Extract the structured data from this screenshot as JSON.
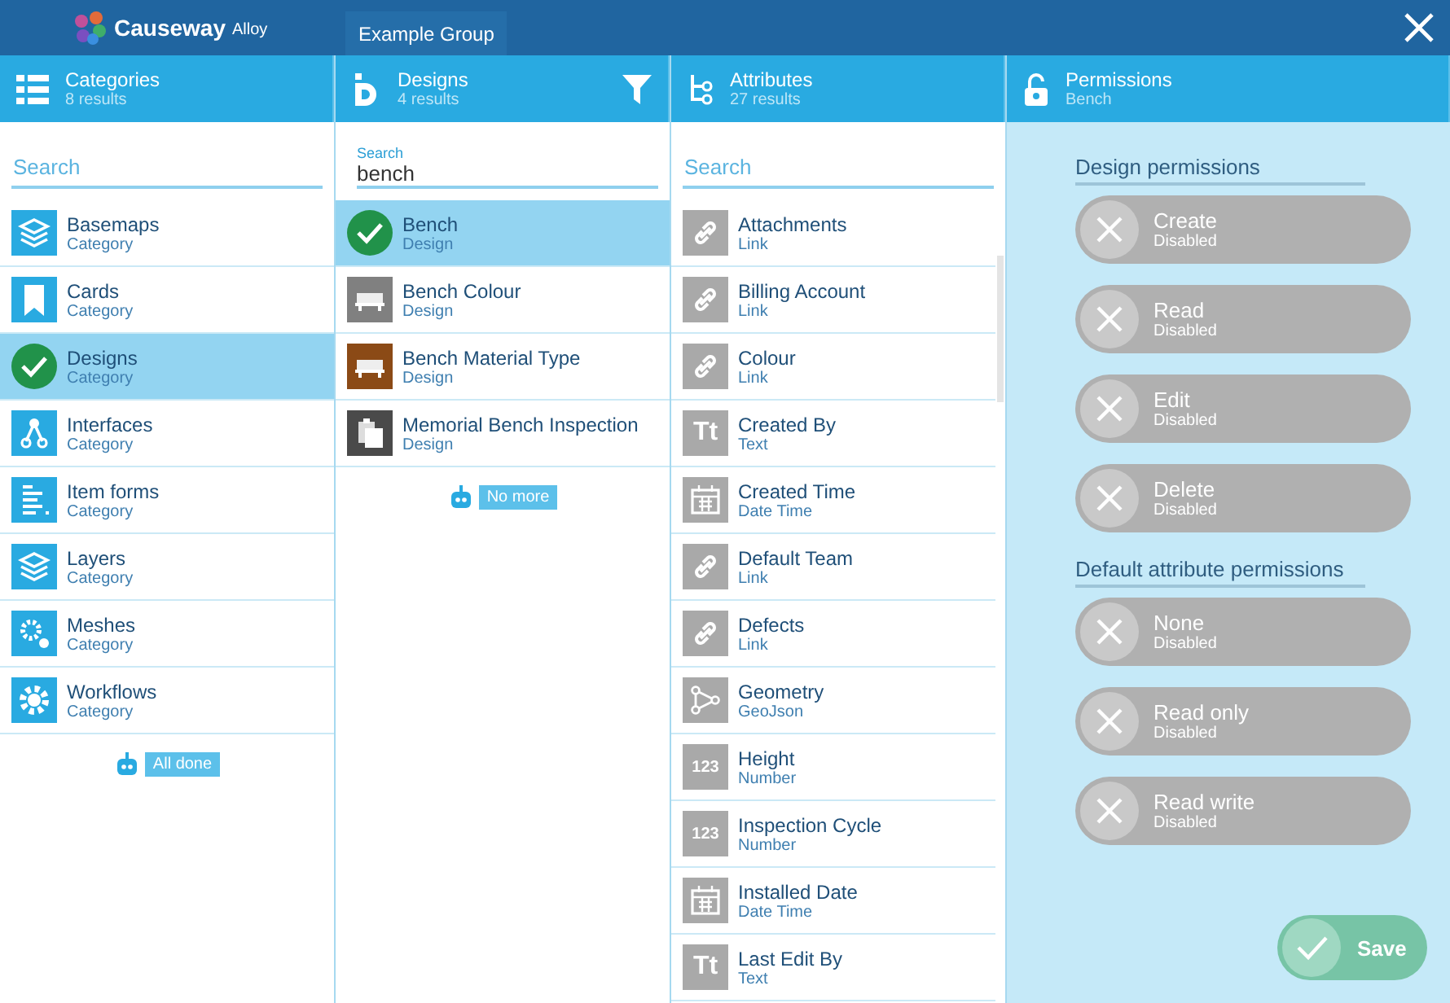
{
  "topbar": {
    "brand": "Causeway",
    "brand_suffix": "Alloy",
    "group": "Example Group"
  },
  "categories": {
    "title": "Categories",
    "subtitle": "8 results",
    "search": {
      "placeholder": "Search"
    },
    "items": [
      {
        "name": "Basemaps",
        "type": "Category",
        "kind": "stack",
        "selected": false
      },
      {
        "name": "Cards",
        "type": "Category",
        "kind": "bookmark",
        "selected": false
      },
      {
        "name": "Designs",
        "type": "Category",
        "selected": true
      },
      {
        "name": "Interfaces",
        "type": "Category",
        "kind": "nodes",
        "selected": false
      },
      {
        "name": "Item forms",
        "type": "Category",
        "kind": "form",
        "selected": false
      },
      {
        "name": "Layers",
        "type": "Category",
        "kind": "stack",
        "selected": false
      },
      {
        "name": "Meshes",
        "type": "Category",
        "kind": "gears",
        "selected": false
      },
      {
        "name": "Workflows",
        "type": "Category",
        "kind": "gear",
        "selected": false
      }
    ],
    "footer": "All done"
  },
  "designs": {
    "title": "Designs",
    "subtitle": "4 results",
    "search": {
      "label": "Search",
      "value": "bench"
    },
    "items": [
      {
        "name": "Bench",
        "type": "Design",
        "selected": true
      },
      {
        "name": "Bench Colour",
        "type": "Design",
        "kind": "bench",
        "color": "#808080",
        "selected": false
      },
      {
        "name": "Bench Material Type",
        "type": "Design",
        "kind": "bench",
        "color": "#8b4a16",
        "selected": false
      },
      {
        "name": "Memorial Bench Inspection",
        "type": "Design",
        "kind": "clipboard",
        "color": "#4a4a4a",
        "selected": false
      }
    ],
    "footer": "No more"
  },
  "attributes": {
    "title": "Attributes",
    "subtitle": "27 results",
    "search": {
      "placeholder": "Search"
    },
    "items": [
      {
        "name": "Attachments",
        "type": "Link",
        "kind": "link"
      },
      {
        "name": "Billing Account",
        "type": "Link",
        "kind": "link"
      },
      {
        "name": "Colour",
        "type": "Link",
        "kind": "link"
      },
      {
        "name": "Created By",
        "type": "Text",
        "kind": "text",
        "icon_text": "Tt"
      },
      {
        "name": "Created Time",
        "type": "Date Time",
        "kind": "calendar"
      },
      {
        "name": "Default Team",
        "type": "Link",
        "kind": "link"
      },
      {
        "name": "Defects",
        "type": "Link",
        "kind": "link"
      },
      {
        "name": "Geometry",
        "type": "GeoJson",
        "kind": "geo"
      },
      {
        "name": "Height",
        "type": "Number",
        "kind": "number",
        "icon_text": "123"
      },
      {
        "name": "Inspection Cycle",
        "type": "Number",
        "kind": "number",
        "icon_text": "123"
      },
      {
        "name": "Installed Date",
        "type": "Date Time",
        "kind": "calendar"
      },
      {
        "name": "Last Edit By",
        "type": "Text",
        "kind": "text",
        "icon_text": "Tt"
      }
    ]
  },
  "permissions": {
    "title": "Permissions",
    "subtitle": "Bench",
    "sections": [
      {
        "heading": "Design permissions",
        "toggles": [
          {
            "label": "Create",
            "state": "Disabled",
            "on": false
          },
          {
            "label": "Read",
            "state": "Disabled",
            "on": false
          },
          {
            "label": "Edit",
            "state": "Disabled",
            "on": false
          },
          {
            "label": "Delete",
            "state": "Disabled",
            "on": false
          }
        ]
      },
      {
        "heading": "Default attribute permissions",
        "toggles": [
          {
            "label": "None",
            "state": "Disabled",
            "on": false
          },
          {
            "label": "Read only",
            "state": "Disabled",
            "on": false
          },
          {
            "label": "Read write",
            "state": "Disabled",
            "on": false
          }
        ]
      }
    ],
    "save": "Save"
  }
}
